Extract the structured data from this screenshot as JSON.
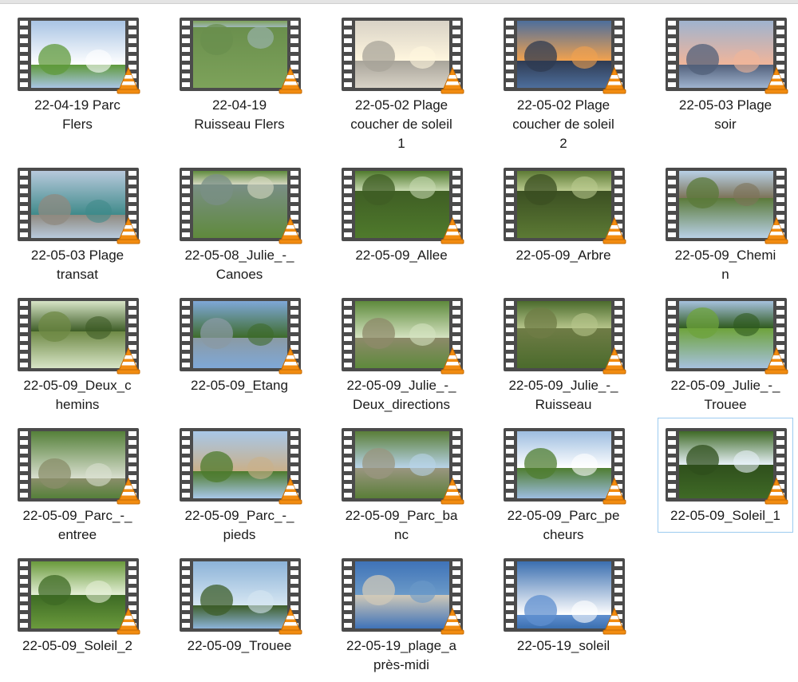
{
  "items": [
    {
      "label": "22-04-19 Parc\nFlers",
      "sky": "#a9c4e4",
      "ground": "#5f9a3b",
      "accent": "#ffffff",
      "horizon": 65,
      "selected": false
    },
    {
      "label": "22-04-19\nRuisseau Flers",
      "sky": "#7da25a",
      "ground": "#6a8f4d",
      "accent": "#9fb7b8",
      "horizon": 10,
      "selected": false
    },
    {
      "label": "22-05-02 Plage\ncoucher de soleil\n1",
      "sky": "#d8d2c6",
      "ground": "#a8a49a",
      "accent": "#fff6de",
      "horizon": 60,
      "selected": false
    },
    {
      "label": "22-05-02 Plage\ncoucher de soleil\n2",
      "sky": "#4d6e9c",
      "ground": "#2f3b52",
      "accent": "#f2a24e",
      "horizon": 60,
      "selected": false
    },
    {
      "label": "22-05-03 Plage\nsoir",
      "sky": "#9fb3cf",
      "ground": "#52607a",
      "accent": "#f0b59a",
      "horizon": 65,
      "selected": false
    },
    {
      "label": "22-05-03 Plage\ntransat",
      "sky": "#b7c9dc",
      "ground": "#8f8a80",
      "accent": "#3f8a8a",
      "horizon": 65,
      "selected": false
    },
    {
      "label": "22-05-08_Julie_-_\nCanoes",
      "sky": "#5f8a3c",
      "ground": "#7a8f86",
      "accent": "#d6d8c2",
      "horizon": 20,
      "selected": false
    },
    {
      "label": "22-05-09_Allee",
      "sky": "#4f7a2c",
      "ground": "#3f5e24",
      "accent": "#c7d9b0",
      "horizon": 30,
      "selected": false
    },
    {
      "label": "22-05-09_Arbre",
      "sky": "#5c7a34",
      "ground": "#3b4f22",
      "accent": "#b9c98e",
      "horizon": 30,
      "selected": false
    },
    {
      "label": "22-05-09_Chemi\nn",
      "sky": "#b8d0e6",
      "ground": "#5b7a3a",
      "accent": "#7d7358",
      "horizon": 40,
      "selected": false
    },
    {
      "label": "22-05-09_Deux_c\nhemins",
      "sky": "#d7e4c6",
      "ground": "#6f8a46",
      "accent": "#3d5c26",
      "horizon": 45,
      "selected": false
    },
    {
      "label": "22-05-09_Etang",
      "sky": "#7fa8d8",
      "ground": "#8a9aa4",
      "accent": "#3e6b2b",
      "horizon": 55,
      "selected": false
    },
    {
      "label": "22-05-09_Julie_-_\nDeux_directions",
      "sky": "#5e8a3c",
      "ground": "#8d8a6a",
      "accent": "#d4e2c0",
      "horizon": 55,
      "selected": false
    },
    {
      "label": "22-05-09_Julie_-_\nRuisseau",
      "sky": "#4b6b2c",
      "ground": "#6f7c46",
      "accent": "#b5c48a",
      "horizon": 40,
      "selected": false
    },
    {
      "label": "22-05-09_Julie_-_\nTrouee",
      "sky": "#a6c1de",
      "ground": "#6ea33c",
      "accent": "#2f5a1e",
      "horizon": 40,
      "selected": false
    },
    {
      "label": "22-05-09_Parc_-_\nentree",
      "sky": "#55803a",
      "ground": "#8a8e6a",
      "accent": "#d9dfcf",
      "horizon": 70,
      "selected": false
    },
    {
      "label": "22-05-09_Parc_-_\npieds",
      "sky": "#a8c7e8",
      "ground": "#4e7b2d",
      "accent": "#c9b08a",
      "horizon": 60,
      "selected": false
    },
    {
      "label": "22-05-09_Parc_ba\nnc",
      "sky": "#5a7e38",
      "ground": "#9a9680",
      "accent": "#b8d3e8",
      "horizon": 55,
      "selected": false
    },
    {
      "label": "22-05-09_Parc_pe\ncheurs",
      "sky": "#9dbde0",
      "ground": "#4f7d30",
      "accent": "#ffffff",
      "horizon": 55,
      "selected": false
    },
    {
      "label": "22-05-09_Soleil_1",
      "sky": "#3f6a26",
      "ground": "#2f4f1c",
      "accent": "#e6f0f6",
      "horizon": 50,
      "selected": true
    },
    {
      "label": "22-05-09_Soleil_2",
      "sky": "#6a9a3c",
      "ground": "#3d6a24",
      "accent": "#e4efd6",
      "horizon": 50,
      "selected": false
    },
    {
      "label": "22-05-09_Trouee",
      "sky": "#8cb3d8",
      "ground": "#3e5e2a",
      "accent": "#d6e6f2",
      "horizon": 65,
      "selected": false
    },
    {
      "label": "22-05-19_plage_a\nprès-midi",
      "sky": "#3f73b8",
      "ground": "#cfc8b8",
      "accent": "#6b9ac8",
      "horizon": 50,
      "selected": false
    },
    {
      "label": "22-05-19_soleil",
      "sky": "#3b6fb0",
      "ground": "#5f8fcf",
      "accent": "#ffffff",
      "horizon": 80,
      "selected": false
    }
  ]
}
